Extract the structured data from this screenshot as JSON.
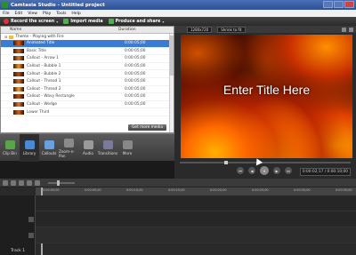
{
  "window": {
    "title": "Camtasia Studio - Untitled project"
  },
  "menu": [
    "File",
    "Edit",
    "View",
    "Play",
    "Tools",
    "Help"
  ],
  "toolbar": {
    "record_label": "Record the screen",
    "import_label": "Import media",
    "produce_label": "Produce and share"
  },
  "library": {
    "col_name": "Name",
    "col_duration": "Duration",
    "group_label": "Theme - Playing with Fire",
    "items": [
      {
        "name": "Animated Title",
        "duration": "0:00:05;00",
        "color": "#e05a1a"
      },
      {
        "name": "Basic Title",
        "duration": "0:00:05;00",
        "color": "#c9611f"
      },
      {
        "name": "Callout - Arrow 1",
        "duration": "0:00:05;00",
        "color": "#d97b2a"
      },
      {
        "name": "Callout - Bubble 1",
        "duration": "0:00:05;00",
        "color": "#e8952e"
      },
      {
        "name": "Callout - Bubble 2",
        "duration": "0:00:05;00",
        "color": "#b84a18"
      },
      {
        "name": "Callout - Thread 1",
        "duration": "0:00:05;00",
        "color": "#da6b22"
      },
      {
        "name": "Callout - Thread 2",
        "duration": "0:00:05;00",
        "color": "#f0a040"
      },
      {
        "name": "Callout - Wavy Rectangle",
        "duration": "0:00:05;00",
        "color": "#c05020"
      },
      {
        "name": "Callout - Wedge",
        "duration": "0:00:05;00",
        "color": "#e07830"
      },
      {
        "name": "Lower Third",
        "duration": "",
        "color": "#d06020"
      }
    ],
    "get_more_label": "Get more media"
  },
  "tabs": [
    {
      "label": "Clip Bin",
      "color": "#5aa54a"
    },
    {
      "label": "Library",
      "color": "#4a8ad4"
    },
    {
      "label": "Callouts",
      "color": "#6aa0e0"
    },
    {
      "label": "Zoom-n-Pan",
      "color": "#8a8a8a"
    },
    {
      "label": "Audio",
      "color": "#9a9a9a"
    },
    {
      "label": "Transitions",
      "color": "#7a7a9a"
    },
    {
      "label": "More",
      "color": "#888888"
    }
  ],
  "preview": {
    "resolution": "1280x720",
    "zoom": "Shrink to fit",
    "title_text": "Enter Title Here",
    "timecode": "0:00:02;17 / 0:00:10;00"
  },
  "timeline": {
    "ticks": [
      "0:00:00;00",
      "0:00:05;00",
      "0:00:10;00",
      "0:00:15;00",
      "0:00:20;00",
      "0:00:25;00",
      "0:00:30;00",
      "0:00:35;00"
    ],
    "track_label": "Track 1"
  }
}
